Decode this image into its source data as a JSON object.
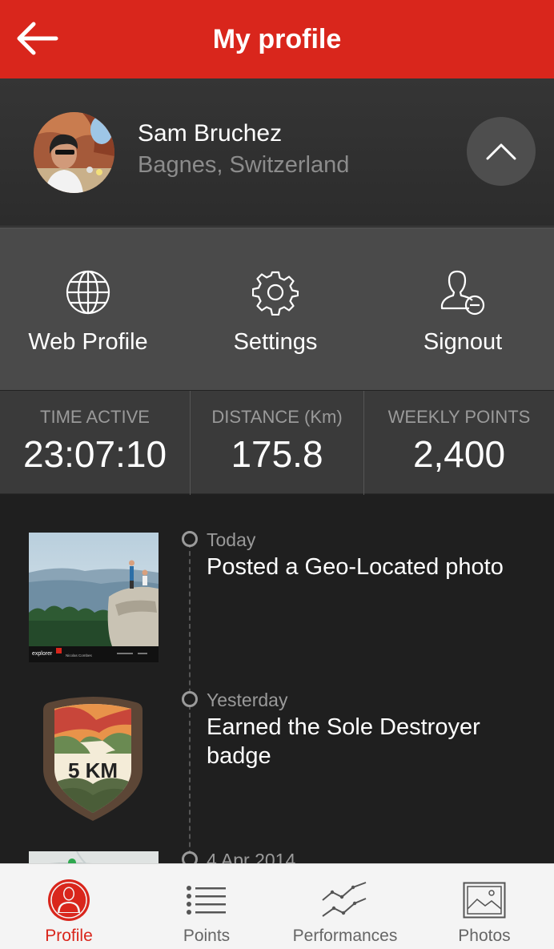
{
  "header": {
    "title": "My profile",
    "back_icon": "arrow-left-icon",
    "color": "#d9261c"
  },
  "profile": {
    "name": "Sam Bruchez",
    "location": "Bagnes, Switzerland",
    "collapse_icon": "chevron-up-icon"
  },
  "actions": [
    {
      "label": "Web Profile",
      "icon": "globe-icon"
    },
    {
      "label": "Settings",
      "icon": "gear-icon"
    },
    {
      "label": "Signout",
      "icon": "user-minus-icon"
    }
  ],
  "stats": [
    {
      "label": "TIME ACTIVE",
      "value": "23:07:10"
    },
    {
      "label": "DISTANCE (Km)",
      "value": "175.8"
    },
    {
      "label": "WEEKLY POINTS",
      "value": "2,400"
    }
  ],
  "feed": [
    {
      "date": "Today",
      "text": "Posted a Geo-Located photo",
      "thumb": "geo-photo"
    },
    {
      "date": "Yesterday",
      "text": "Earned the Sole Destroyer badge",
      "thumb": "badge",
      "badge_text": "5 KM"
    },
    {
      "date": "4 Apr 2014",
      "text": "",
      "thumb": "map"
    }
  ],
  "photo_thumb_text": {
    "brand": "explorer",
    "name": "Nicolas Combes"
  },
  "tabs": [
    {
      "label": "Profile",
      "icon": "person-icon",
      "active": true
    },
    {
      "label": "Points",
      "icon": "list-icon",
      "active": false
    },
    {
      "label": "Performances",
      "icon": "line-chart-icon",
      "active": false
    },
    {
      "label": "Photos",
      "icon": "picture-icon",
      "active": false
    }
  ],
  "colors": {
    "accent": "#d9261c",
    "inactive_tab": "#666666"
  }
}
